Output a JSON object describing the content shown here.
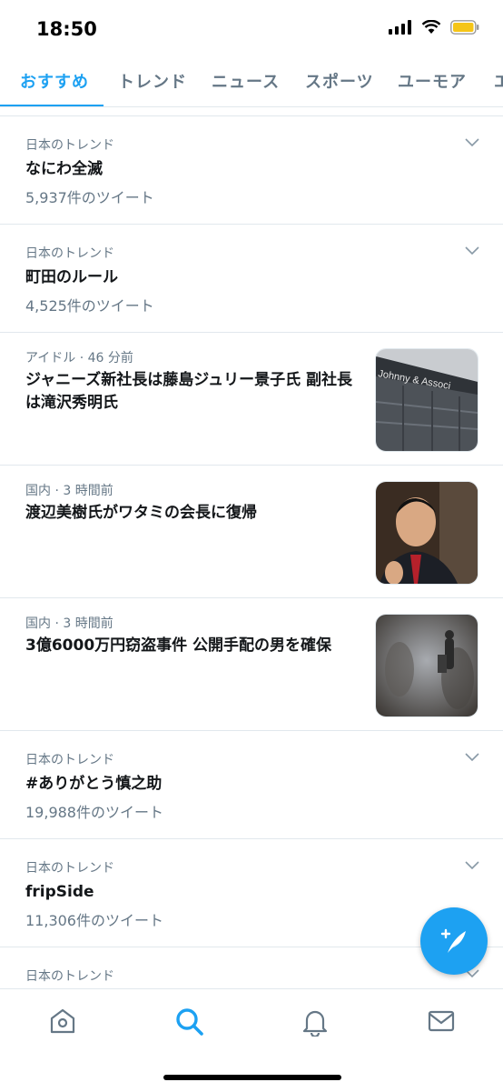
{
  "status": {
    "time": "18:50"
  },
  "tabs": [
    {
      "label": "おすすめ",
      "active": true
    },
    {
      "label": "トレンド"
    },
    {
      "label": "ニュース"
    },
    {
      "label": "スポーツ"
    },
    {
      "label": "ユーモア"
    },
    {
      "label": "エ"
    }
  ],
  "feed": [
    {
      "kind": "trend",
      "meta": "日本のトレンド",
      "title": "なにわ全滅",
      "count": "5,937件のツイート"
    },
    {
      "kind": "trend",
      "meta": "日本のトレンド",
      "title": "町田のルール",
      "count": "4,525件のツイート"
    },
    {
      "kind": "news",
      "meta": "アイドル · 46 分前",
      "title": "ジャニーズ新社長は藤島ジュリー景子氏 副社長は滝沢秀明氏",
      "image": "building-photo",
      "image_text": "Johnny & Associ"
    },
    {
      "kind": "news",
      "meta": "国内 · 3 時間前",
      "title": "渡辺美樹氏がワタミの会長に復帰",
      "image": "man-portrait-photo"
    },
    {
      "kind": "news",
      "meta": "国内 · 3 時間前",
      "title": "3億6000万円窃盗事件 公開手配の男を確保",
      "image": "blurred-scene-photo"
    },
    {
      "kind": "trend",
      "meta": "日本のトレンド",
      "title": "#ありがとう慎之助",
      "count": "19,988件のツイート"
    },
    {
      "kind": "trend",
      "meta": "日本のトレンド",
      "title": "fripSide",
      "count": "11,306件のツイート"
    },
    {
      "kind": "trend",
      "meta": "日本のトレンド"
    }
  ],
  "bottom_nav": [
    {
      "icon": "home-icon",
      "active": false
    },
    {
      "icon": "search-icon",
      "active": true
    },
    {
      "icon": "bell-icon",
      "active": false
    },
    {
      "icon": "mail-icon",
      "active": false
    }
  ],
  "colors": {
    "accent": "#1da1f2",
    "secondary_text": "#657786",
    "divider": "#e1e8ed"
  }
}
